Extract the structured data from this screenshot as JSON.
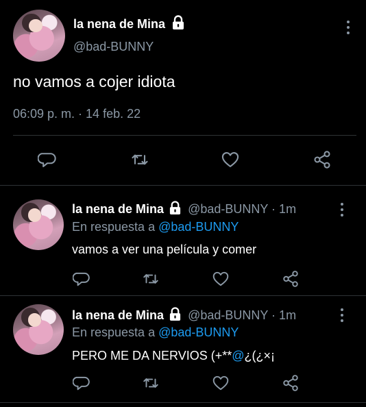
{
  "main_tweet": {
    "display_name": "la nena de Mina",
    "handle": "@bad-BUNNY",
    "text": "no vamos a cojer idiota",
    "timestamp": "06:09 p. m. · 14 feb. 22",
    "protected_icon": "lock-icon",
    "more_icon": "more-vertical-icon"
  },
  "action_icons": [
    "comment-icon",
    "retweet-icon",
    "like-icon",
    "share-icon"
  ],
  "replies": [
    {
      "display_name": "la nena de Mina",
      "handle_meta": "@bad-BUNNY · 1m",
      "reply_prefix": "En respuesta a",
      "reply_to": "@bad-BUNNY",
      "text": "vamos a ver una película y comer"
    },
    {
      "display_name": "la nena de Mina",
      "handle_meta": "@bad-BUNNY · 1m",
      "reply_prefix": "En respuesta a",
      "reply_to": "@bad-BUNNY",
      "text_before": "PERO ME DA NERVIOS (+**",
      "text_mention": "@",
      "text_after": "¿(¿×¡"
    }
  ],
  "colors": {
    "background": "#000000",
    "text_primary": "#ffffff",
    "text_secondary": "#8b98a5",
    "mention": "#1d9bf0",
    "divider": "#2f3336"
  }
}
